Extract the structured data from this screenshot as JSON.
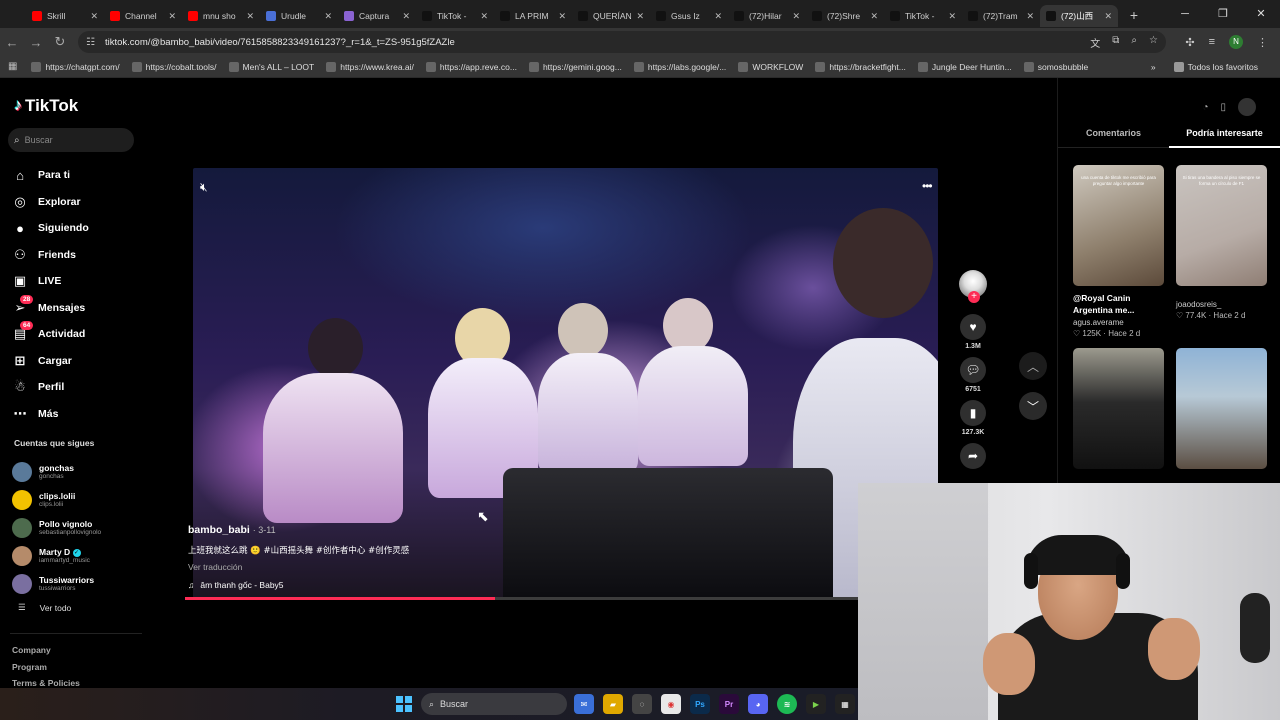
{
  "browser": {
    "tabs": [
      {
        "label": "Skrill",
        "color": "#ff0000"
      },
      {
        "label": "Channel",
        "color": "#ff0000"
      },
      {
        "label": "mnu sho",
        "color": "#ff0000"
      },
      {
        "label": "Urudle",
        "color": "#4a6fd6"
      },
      {
        "label": "Captura",
        "color": "#8a63d2"
      },
      {
        "label": "TikTok -",
        "color": "#111111"
      },
      {
        "label": "LA PRIM",
        "color": "#111111"
      },
      {
        "label": "QUERÍAN",
        "color": "#111111"
      },
      {
        "label": "Gsus Iz",
        "color": "#111111"
      },
      {
        "label": "(72)Hilar",
        "color": "#111111"
      },
      {
        "label": "(72)Shre",
        "color": "#111111"
      },
      {
        "label": "TikTok -",
        "color": "#111111"
      },
      {
        "label": "(72)Tram",
        "color": "#111111"
      },
      {
        "label": "(72)山西",
        "color": "#111111"
      }
    ],
    "url": "tiktok.com/@bambo_babi/video/7615858823349161237?_r=1&_t=ZS-951g5fZAZle",
    "profile_initial": "N",
    "bookmarks": [
      "https://chatgpt.com/",
      "https://cobalt.tools/",
      "Men's ALL – LOOT",
      "https://www.krea.ai/",
      "https://app.reve.co...",
      "https://gemini.goog...",
      "https://labs.google/...",
      "WORKFLOW",
      "https://bracketfight...",
      "Jungle Deer Huntin...",
      "somosbubble"
    ],
    "bookmarks_all": "Todos los favoritos"
  },
  "tiktok": {
    "brand": "TikTok",
    "search_placeholder": "Buscar",
    "nav": [
      {
        "label": "Para ti",
        "icon": "home-icon",
        "glyph": "⌂"
      },
      {
        "label": "Explorar",
        "icon": "compass-icon",
        "glyph": "◎"
      },
      {
        "label": "Siguiendo",
        "icon": "following-icon",
        "glyph": "●"
      },
      {
        "label": "Friends",
        "icon": "friends-icon",
        "glyph": "⚇"
      },
      {
        "label": "LIVE",
        "icon": "live-icon",
        "glyph": "▣"
      },
      {
        "label": "Mensajes",
        "icon": "messages-icon",
        "glyph": "➢",
        "badge": "28"
      },
      {
        "label": "Actividad",
        "icon": "activity-icon",
        "glyph": "▤",
        "badge": "64"
      },
      {
        "label": "Cargar",
        "icon": "upload-icon",
        "glyph": "⊞"
      },
      {
        "label": "Perfil",
        "icon": "profile-icon",
        "glyph": "☃"
      },
      {
        "label": "Más",
        "icon": "more-icon",
        "glyph": "⋯"
      }
    ],
    "following_title": "Cuentas que sigues",
    "following": [
      {
        "name": "gonchas",
        "handle": "gonchas",
        "color": "#5a7a9a"
      },
      {
        "name": "clips.lolii",
        "handle": "clips.lolii",
        "color": "#f2c200"
      },
      {
        "name": "Pollo vignolo",
        "handle": "sebastianpollovignolo",
        "color": "#4d6b4d"
      },
      {
        "name": "Marty D",
        "handle": "iammartyd_music",
        "color": "#b58b6a",
        "verified": true
      },
      {
        "name": "Tussiwarriors",
        "handle": "tussiwarriors",
        "color": "#7a6fa0"
      }
    ],
    "see_all": "Ver todo",
    "footer": [
      "Company",
      "Program",
      "Terms & Policies"
    ]
  },
  "video": {
    "username": "bambo_babi",
    "date": "· 3-11",
    "description": "上班我就这么跳 🙂 #山西摇头舞 #创作者中心 #创作灵感",
    "translate": "Ver traducción",
    "sound": "âm thanh gốc - Baby5",
    "progress_fraction": 0.46,
    "likes": "1.3M",
    "comments": "6751",
    "saves": "127.3K"
  },
  "right_panel": {
    "tabs": [
      "Comentarios",
      "Podría interesarte"
    ],
    "active_tab": 1,
    "cards": [
      {
        "title": "@Royal Canin Argentina me...",
        "user": "agus.averame",
        "meta": "♡ 125K · Hace 2 d",
        "overlay": "una cuenta de tiktok me escribió para preguntar algo importante",
        "bg": "linear-gradient(160deg,#cfc9bf,#8e7f6c 60%,#5c4a3a)"
      },
      {
        "title": "",
        "user": "joaodosreis_",
        "meta": "♡ 77.4K · Hace 2 d",
        "overlay": "Si tiras una bandera al piso siempre se forma un círculo de F1",
        "bg": "linear-gradient(160deg,#c9c4c0,#b7aca6 60%,#8f7e74)"
      },
      {
        "title": "",
        "user": "",
        "meta": "",
        "overlay": "",
        "bg": "linear-gradient(180deg,#9c9a8e,#2a2a2a 45%,#111 100%)"
      },
      {
        "title": "",
        "user": "",
        "meta": "",
        "overlay": "",
        "bg": "linear-gradient(180deg,#8fb3d6,#b7c9d6 40%,#5b4e42 100%)"
      }
    ]
  },
  "taskbar": {
    "search": "Buscar"
  }
}
